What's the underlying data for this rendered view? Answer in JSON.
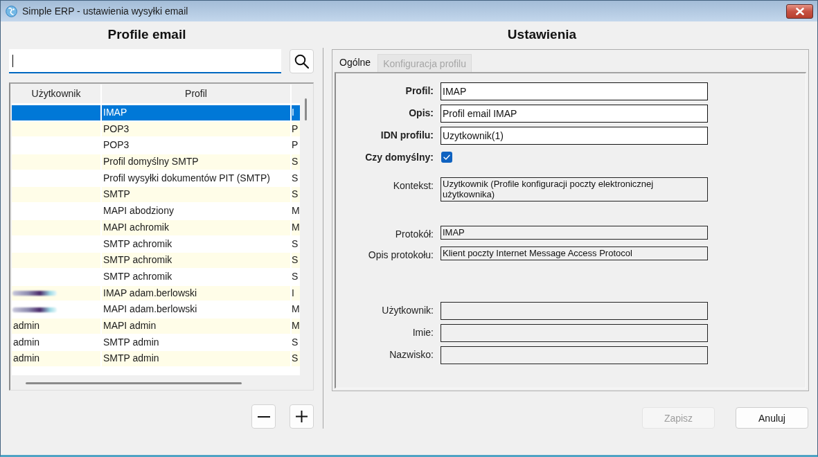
{
  "window": {
    "title": "Simple ERP - ustawienia wysyłki email"
  },
  "profiles_panel": {
    "heading": "Profile email",
    "search": {
      "focused": true
    },
    "table": {
      "columns": [
        "Użytkownik",
        "Profil"
      ],
      "rows": [
        {
          "user_blurred": false,
          "profile": "IMAP",
          "column_3": "I",
          "selected": true
        },
        {
          "user_blurred": false,
          "profile": "POP3",
          "column_3": "P",
          "selected": false
        },
        {
          "user_blurred": false,
          "profile": "POP3",
          "column_3": "P",
          "selected": false
        },
        {
          "user_blurred": false,
          "profile": "Profil domyślny SMTP",
          "column_3": "S",
          "selected": false
        },
        {
          "user_blurred": false,
          "profile": "Profil wysyłki dokumentów PIT (SMTP)",
          "column_3": "S",
          "selected": false
        },
        {
          "user_blurred": false,
          "profile": "SMTP",
          "column_3": "S",
          "selected": false
        },
        {
          "user_blurred": false,
          "profile": "MAPI abodziony",
          "column_3": "M",
          "selected": false
        },
        {
          "user_blurred": false,
          "profile": "MAPI achromik",
          "column_3": "M",
          "selected": false
        },
        {
          "user_blurred": false,
          "profile": "SMTP achromik",
          "column_3": "S",
          "selected": false
        },
        {
          "user_blurred": false,
          "profile": "SMTP achromik",
          "column_3": "S",
          "selected": false
        },
        {
          "user_blurred": false,
          "profile": "SMTP achromik",
          "column_3": "S",
          "selected": false
        },
        {
          "user_blurred": true,
          "profile": "IMAP adam.berlowski",
          "column_3": "I",
          "selected": false
        },
        {
          "user_blurred": true,
          "profile": "MAPI adam.berlowski",
          "column_3": "M",
          "selected": false
        },
        {
          "user_blurred": false,
          "user": "admin",
          "profile": "MAPI admin",
          "column_3": "M",
          "selected": false
        },
        {
          "user_blurred": false,
          "user": "admin",
          "profile": "SMTP admin",
          "column_3": "S",
          "selected": false
        },
        {
          "user_blurred": false,
          "user": "admin",
          "profile": "SMTP admin",
          "column_3": "S",
          "selected": false
        }
      ]
    }
  },
  "settings_panel": {
    "heading": "Ustawienia",
    "tabs": [
      {
        "label": "Ogólne",
        "selected": true,
        "disabled": false
      },
      {
        "label": "Konfiguracja profilu",
        "selected": false,
        "disabled": true
      }
    ],
    "form": {
      "groups": [
        [
          {
            "kind": "input",
            "label": "Profil:",
            "value": "IMAP",
            "required": true
          },
          {
            "kind": "input",
            "label": "Opis:",
            "value": "Profil email IMAP",
            "required": true
          },
          {
            "kind": "input",
            "label": "IDN profilu:",
            "value": "Uzytkownik(1)",
            "required": true
          },
          {
            "kind": "checkbox",
            "label": "Czy domyślny:",
            "checked": true,
            "required": true
          }
        ],
        [
          {
            "kind": "readonly",
            "label": "Kontekst:",
            "value": "Uzytkownik (Profile konfiguracji poczty elektronicznej użytkownika)",
            "required": false
          }
        ],
        [
          {
            "kind": "readonly",
            "label": "Protokół:",
            "value": "IMAP",
            "required": false
          },
          {
            "kind": "readonly",
            "label": "Opis protokołu:",
            "value": "Klient poczty Internet Message Access Protocol",
            "required": false
          }
        ],
        [
          {
            "kind": "readonly",
            "label": "Użytkownik:",
            "required": false
          },
          {
            "kind": "readonly",
            "label": "Imie:",
            "required": false
          },
          {
            "kind": "readonly",
            "label": "Nazwisko:",
            "required": false
          }
        ]
      ]
    },
    "buttons": [
      {
        "label": "Zapisz",
        "disabled": true
      },
      {
        "label": "Anuluj",
        "disabled": false
      }
    ]
  }
}
